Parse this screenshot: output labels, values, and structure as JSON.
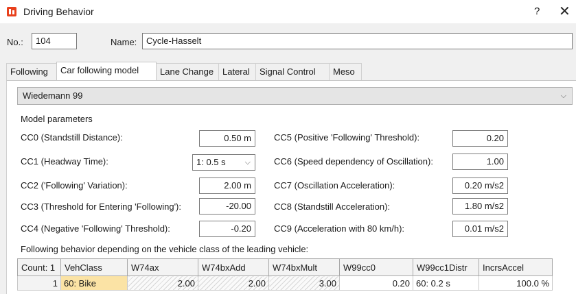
{
  "window": {
    "title": "Driving Behavior",
    "help": "?",
    "close": "✕"
  },
  "header": {
    "no_label": "No.:",
    "no_value": "104",
    "name_label": "Name:",
    "name_value": "Cycle-Hasselt"
  },
  "tabs": [
    {
      "label": "Following"
    },
    {
      "label": "Car following model",
      "active": true
    },
    {
      "label": "Lane Change"
    },
    {
      "label": "Lateral"
    },
    {
      "label": "Signal Control"
    },
    {
      "label": "Meso"
    }
  ],
  "model_select": {
    "value": "Wiedemann 99"
  },
  "params": {
    "heading": "Model parameters",
    "left": [
      {
        "label": "CC0 (Standstill Distance):",
        "value": "0.50 m"
      },
      {
        "label": "CC1 (Headway Time):",
        "value": "1: 0.5 s"
      },
      {
        "label": "CC2 ('Following' Variation):",
        "value": "2.00 m"
      },
      {
        "label": "CC3 (Threshold for Entering 'Following'):",
        "value": "-20.00"
      },
      {
        "label": "CC4 (Negative 'Following' Threshold):",
        "value": "-0.20"
      }
    ],
    "right": [
      {
        "label": "CC5 (Positive 'Following' Threshold):",
        "value": "0.20"
      },
      {
        "label": "CC6 (Speed dependency of Oscillation):",
        "value": "1.00"
      },
      {
        "label": "CC7 (Oscillation Acceleration):",
        "value": "0.20 m/s2"
      },
      {
        "label": "CC8 (Standstill Acceleration):",
        "value": "1.80 m/s2"
      },
      {
        "label": "CC9 (Acceleration with 80 km/h):",
        "value": "0.01 m/s2"
      }
    ]
  },
  "following_table": {
    "caption": "Following behavior depending on the vehicle class of the leading vehicle:",
    "columns": [
      "Count: 1",
      "VehClass",
      "W74ax",
      "W74bxAdd",
      "W74bxMult",
      "W99cc0",
      "W99cc1Distr",
      "IncrsAccel"
    ],
    "rows": [
      [
        "1",
        "60: Bike",
        "2.00",
        "2.00",
        "3.00",
        "0.20",
        "60: 0.2 s",
        "100.0 %"
      ]
    ]
  },
  "colors": {
    "window_bg": "#f0f0f0",
    "panel_bg": "#ffffff",
    "selected_cell": "#fbe3a5",
    "app_icon": "#e8401c"
  }
}
